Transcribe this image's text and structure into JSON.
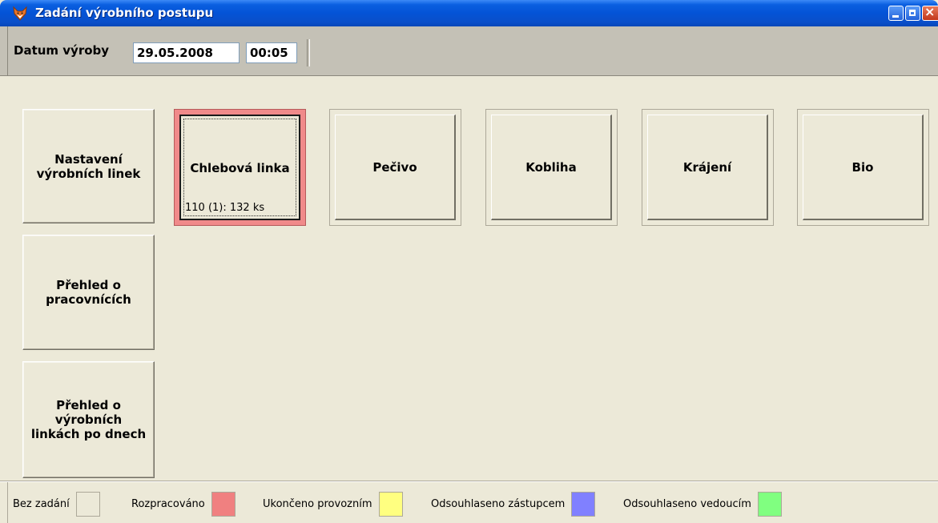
{
  "window": {
    "title": "Zadání výrobního postupu",
    "icon": "fox-app-icon",
    "controls": [
      "minimize-icon",
      "maximize-icon",
      "close-icon"
    ]
  },
  "toolbar": {
    "date_label": "Datum výroby",
    "date_value": "29.05.2008",
    "time_value": "00:05"
  },
  "side_buttons": [
    {
      "label": "Nastavení\nvýrobních linek"
    },
    {
      "label": "Přehled o\npracovnících"
    },
    {
      "label": "Přehled o\nvýrobních\nlinkách po dnech"
    }
  ],
  "production_lines": [
    {
      "label": "Chlebová linka",
      "sub": "110 (1): 132 ks",
      "status": "Rozpracováno"
    },
    {
      "label": "Pečivo"
    },
    {
      "label": "Kobliha"
    },
    {
      "label": "Krájení"
    },
    {
      "label": "Bio"
    }
  ],
  "legend": [
    {
      "label": "Bez zadání",
      "color": "#ece9d8"
    },
    {
      "label": "Rozpracováno",
      "color": "#f08080"
    },
    {
      "label": "Ukončeno provozním",
      "color": "#ffff80"
    },
    {
      "label": "Odsouhlaseno zástupcem",
      "color": "#8080ff"
    },
    {
      "label": "Odsouhlaseno vedoucím",
      "color": "#80ff80"
    }
  ]
}
